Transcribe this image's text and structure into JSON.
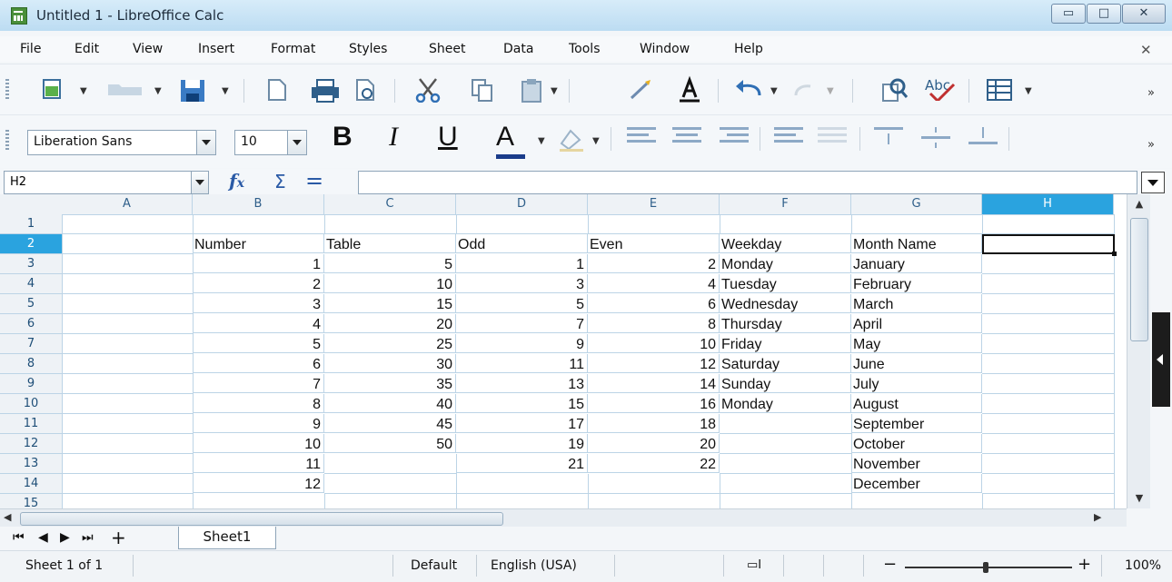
{
  "window": {
    "title": "Untitled 1 - LibreOffice Calc"
  },
  "menu": [
    "File",
    "Edit",
    "View",
    "Insert",
    "Format",
    "Styles",
    "Sheet",
    "Data",
    "Tools",
    "Window",
    "Help"
  ],
  "formatting": {
    "font_name": "Liberation Sans",
    "font_size": "10"
  },
  "formula_bar": {
    "name_box": "H2",
    "formula": ""
  },
  "columns": [
    "A",
    "B",
    "C",
    "D",
    "E",
    "F",
    "G",
    "H"
  ],
  "selected_column": "H",
  "rows": [
    "1",
    "2",
    "3",
    "4",
    "5",
    "6",
    "7",
    "8",
    "9",
    "10",
    "11",
    "12",
    "13",
    "14",
    "15"
  ],
  "selected_row": "2",
  "cells": {
    "header_row": {
      "B": "Number",
      "C": "Table",
      "D": "Odd",
      "E": "Even",
      "F": "Weekday",
      "G": "Month Name"
    },
    "number": [
      "1",
      "2",
      "3",
      "4",
      "5",
      "6",
      "7",
      "8",
      "9",
      "10",
      "11",
      "12"
    ],
    "table": [
      "5",
      "10",
      "15",
      "20",
      "25",
      "30",
      "35",
      "40",
      "45",
      "50"
    ],
    "odd": [
      "1",
      "3",
      "5",
      "7",
      "9",
      "11",
      "13",
      "15",
      "17",
      "19",
      "21"
    ],
    "even": [
      "2",
      "4",
      "6",
      "8",
      "10",
      "12",
      "14",
      "16",
      "18",
      "20",
      "22"
    ],
    "weekday": [
      "Monday",
      "Tuesday",
      "Wednesday",
      "Thursday",
      "Friday",
      "Saturday",
      "Sunday",
      "Monday"
    ],
    "month": [
      "January",
      "February",
      "March",
      "April",
      "May",
      "June",
      "July",
      "August",
      "September",
      "October",
      "November",
      "December"
    ]
  },
  "active_cell": "H2",
  "sheet_tabs": [
    "Sheet1"
  ],
  "status": {
    "sheet": "Sheet 1 of 1",
    "page_style": "Default",
    "language": "English (USA)",
    "zoom": "100%"
  },
  "colors": {
    "accent": "#2aa3df",
    "titlebar": "#bcdcf2",
    "grid_line": "#bcd4e6"
  }
}
